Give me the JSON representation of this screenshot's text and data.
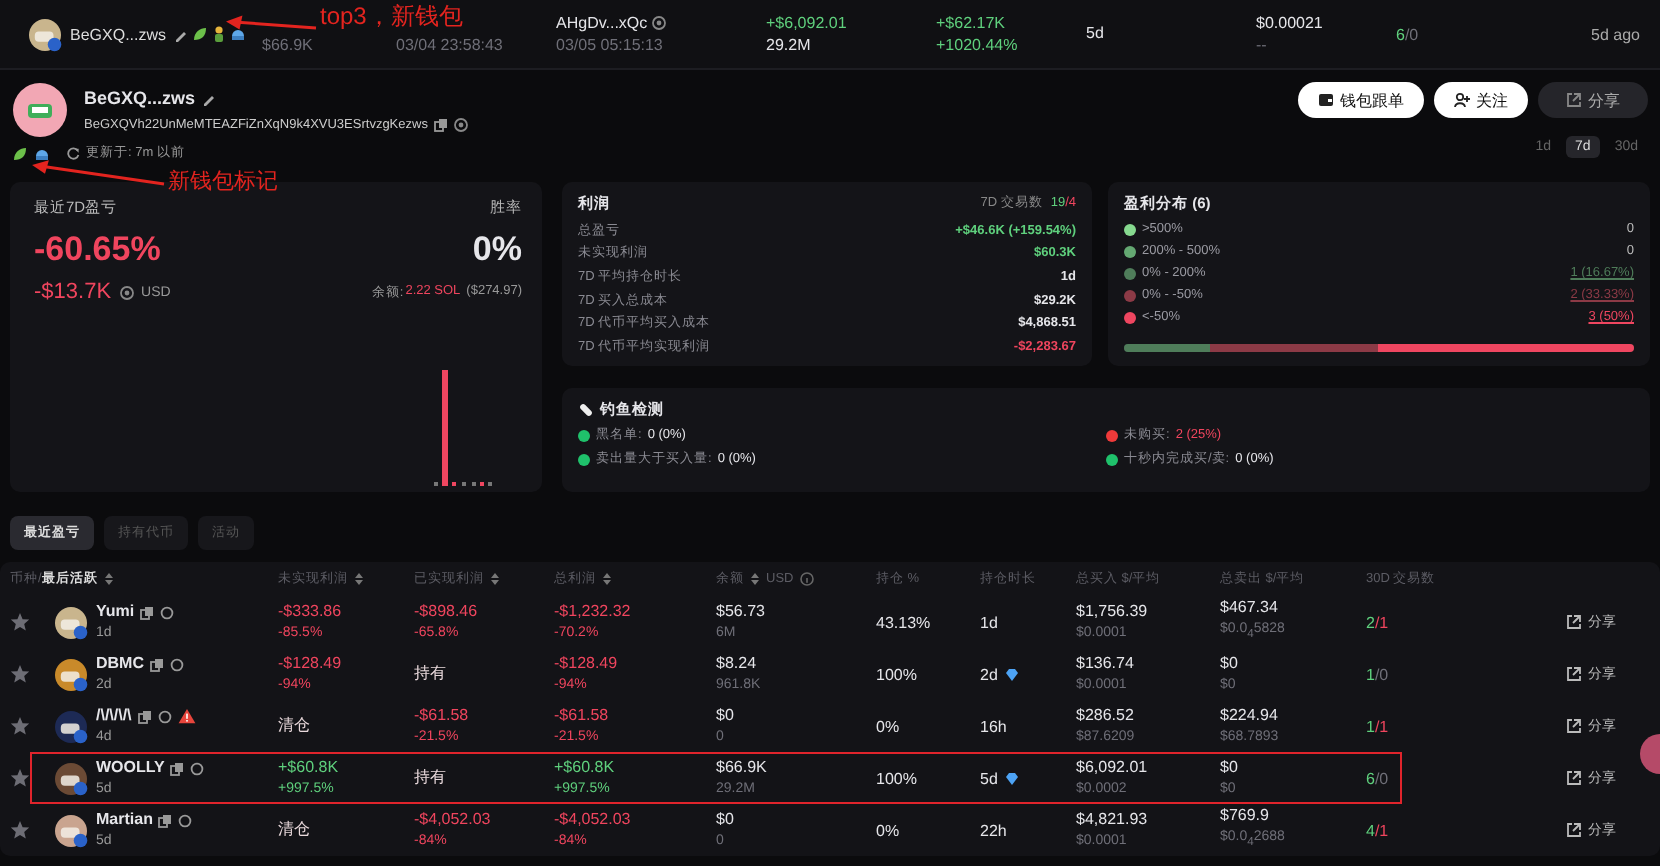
{
  "top_row": {
    "name": "BeGXQ...zws",
    "cells": [
      {
        "lines": [
          {
            "text": "$66.9K",
            "color": "#6f6f78"
          }
        ]
      },
      {
        "lines": [
          {
            "text": "03/04 23:58:43",
            "color": "#6f6f78"
          }
        ]
      },
      {
        "lines": [
          {
            "text": "AHgDv...xQc",
            "color": "#e6e6ea"
          },
          {
            "text": "03/05 05:15:13",
            "color": "#6f6f78"
          }
        ]
      },
      {
        "lines": [
          {
            "text": "+$6,092.01",
            "color": "#5fd07d"
          },
          {
            "text": "29.2M",
            "color": "#e6e6ea"
          }
        ]
      },
      {
        "lines": [
          {
            "text": "+$62.17K",
            "color": "#5fd07d"
          },
          {
            "text": "+1020.44%",
            "color": "#5fd07d"
          }
        ]
      },
      {
        "lines": [
          {
            "text": "5d",
            "color": "#e6e6ea"
          }
        ]
      },
      {
        "lines": [
          {
            "text": "$0.00021",
            "color": "#e6e6ea"
          },
          {
            "text": "--",
            "color": "#6f6f78"
          }
        ]
      }
    ],
    "buys": {
      "text": "6",
      "color": "#5fd07d"
    },
    "sells": {
      "text": "/0",
      "color": "#6f6f78"
    },
    "ago": "5d ago"
  },
  "profile": {
    "name": "BeGXQ...zws",
    "address": "BeGXQVh22UnMeMTEAZFiZnXqN9k4XVU3ESrtvzgKezws",
    "updated": "更新于: 7m 以前",
    "buttons": [
      {
        "label": "钱包跟单",
        "kind": "copytrade"
      },
      {
        "label": "关注",
        "kind": "follow"
      },
      {
        "label": "分享",
        "kind": "share"
      }
    ],
    "periods": [
      {
        "label": "1d",
        "selected": false
      },
      {
        "label": "7d",
        "selected": true
      },
      {
        "label": "30d",
        "selected": false
      }
    ]
  },
  "pnl": {
    "title": "最近7D盈亏",
    "winrate_title": "胜率",
    "percent": "-60.65%",
    "winrate": "0%",
    "amount": "-$13.7K",
    "currency": "USD",
    "balance_label": "余额:",
    "balance": "2.22 SOL",
    "balance_usd": "($274.97)"
  },
  "profit": {
    "title": "利润",
    "trades_label": "7D 交易数",
    "buys": {
      "text": "19",
      "color": "#5fd07d"
    },
    "sells": {
      "text": "/4",
      "color": "#f0455e"
    },
    "rows": [
      {
        "label": "总盈亏",
        "value": "+$46.6K (+159.54%)",
        "color": "#5fd07d"
      },
      {
        "label": "未实现利润",
        "value": "$60.3K",
        "color": "#5fd07d"
      },
      {
        "label": "7D 平均持仓时长",
        "value": "1d",
        "color": "#e6e6ea"
      },
      {
        "label": "7D 买入总成本",
        "value": "$29.2K",
        "color": "#e6e6ea"
      },
      {
        "label": "7D 代币平均买入成本",
        "value": "$4,868.51",
        "color": "#e6e6ea"
      },
      {
        "label": "7D 代币平均实现利润",
        "value": "-$2,283.67",
        "color": "#f0455e"
      }
    ]
  },
  "distribution": {
    "title": "盈利分布 (6)",
    "rows": [
      {
        "label": ">500%",
        "value": "0",
        "color": "#86d98f",
        "level": 0,
        "underlined": false
      },
      {
        "label": "200% - 500%",
        "value": "0",
        "color": "#64a872",
        "level": 0,
        "underlined": false
      },
      {
        "label": "0% - 200%",
        "value": "1 (16.67%)",
        "color": "#4f7d5a",
        "level": 0.1667,
        "underlined": true
      },
      {
        "label": "0% - -50%",
        "value": "2 (33.33%)",
        "color": "#8c3a46",
        "level": 0.3333,
        "underlined": true
      },
      {
        "label": "<-50%",
        "value": "3 (50%)",
        "color": "#ef4660",
        "level": 0.5,
        "underlined": true
      }
    ]
  },
  "phishing": {
    "title": "钓鱼检测",
    "items": [
      {
        "label": "黑名单:",
        "value": "0 (0%)",
        "color": "#1fc16b",
        "alert": false
      },
      {
        "label": "未购买:",
        "value": "2 (25%)",
        "color": "#f03a3a",
        "alert": true
      },
      {
        "label": "卖出量大于买入量:",
        "value": "0 (0%)",
        "color": "#1fc16b",
        "alert": false
      },
      {
        "label": "十秒内完成买/卖:",
        "value": "0 (0%)",
        "color": "#1fc16b",
        "alert": false
      }
    ]
  },
  "tabs": [
    {
      "label": "最近盈亏",
      "selected": true
    },
    {
      "label": "持有代币",
      "selected": false
    },
    {
      "label": "活动",
      "selected": false
    }
  ],
  "table": {
    "columns": [
      {
        "prefix": "币种/",
        "label": "最后活跃",
        "sortable": true
      },
      {
        "label": "未实现利润",
        "sortable": true
      },
      {
        "label": "已实现利润",
        "sortable": true
      },
      {
        "label": "总利润",
        "sortable": true
      },
      {
        "label": "余额",
        "sortable": true,
        "unit": "USD"
      },
      {
        "label": "持仓 %",
        "sortable": false
      },
      {
        "label": "持仓时长",
        "sortable": false
      },
      {
        "label": "总买入 $/平均",
        "sortable": false
      },
      {
        "label": "总卖出 $/平均",
        "sortable": false
      },
      {
        "label": "30D 交易数",
        "sortable": false
      }
    ],
    "rows": [
      {
        "name": "Yumi",
        "age": "1d",
        "warning": false,
        "boxed": false,
        "unrealized": {
          "main": "-$333.86",
          "sub": "-85.5%",
          "color": "#f0455e"
        },
        "realized": {
          "main": "-$898.46",
          "sub": "-65.8%",
          "color": "#f0455e"
        },
        "total": {
          "main": "-$1,232.32",
          "sub": "-70.2%",
          "color": "#f0455e"
        },
        "balance": {
          "main": "$56.73",
          "sub": "6M"
        },
        "hold": "43.13%",
        "duration": "1d",
        "diamond": false,
        "buy": {
          "main": "$1,756.39",
          "sub": "$0.0001"
        },
        "sell": {
          "main": "$467.34",
          "sub": "$0.0$_{4}$5828"
        },
        "buys": {
          "text": "2",
          "color": "#5fd07d"
        },
        "sells": {
          "text": "/1",
          "color": "#f0455e"
        },
        "share": "分享"
      },
      {
        "name": "DBMC",
        "age": "2d",
        "warning": false,
        "boxed": false,
        "unrealized": {
          "main": "-$128.49",
          "sub": "-94%",
          "color": "#f0455e"
        },
        "realized": {
          "label": "持有"
        },
        "total": {
          "main": "-$128.49",
          "sub": "-94%",
          "color": "#f0455e"
        },
        "balance": {
          "main": "$8.24",
          "sub": "961.8K"
        },
        "hold": "100%",
        "duration": "2d",
        "diamond": true,
        "buy": {
          "main": "$136.74",
          "sub": "$0.0001"
        },
        "sell": {
          "main": "$0",
          "sub": "$0"
        },
        "buys": {
          "text": "1",
          "color": "#5fd07d"
        },
        "sells": {
          "text": "/0",
          "color": "#6f6f78"
        },
        "share": "分享"
      },
      {
        "name": "/\\/\\/\\/\\",
        "age": "4d",
        "warning": true,
        "boxed": false,
        "unrealized": {
          "label": "清仓"
        },
        "realized": {
          "main": "-$61.58",
          "sub": "-21.5%",
          "color": "#f0455e"
        },
        "total": {
          "main": "-$61.58",
          "sub": "-21.5%",
          "color": "#f0455e"
        },
        "balance": {
          "main": "$0",
          "sub": "0"
        },
        "hold": "0%",
        "duration": "16h",
        "diamond": false,
        "buy": {
          "main": "$286.52",
          "sub": "$87.6209"
        },
        "sell": {
          "main": "$224.94",
          "sub": "$68.7893"
        },
        "buys": {
          "text": "1",
          "color": "#5fd07d"
        },
        "sells": {
          "text": "/1",
          "color": "#f0455e"
        },
        "share": "分享"
      },
      {
        "name": "WOOLLY",
        "age": "5d",
        "warning": false,
        "boxed": true,
        "unrealized": {
          "main": "+$60.8K",
          "sub": "+997.5%",
          "color": "#5fd07d"
        },
        "realized": {
          "label": "持有"
        },
        "total": {
          "main": "+$60.8K",
          "sub": "+997.5%",
          "color": "#5fd07d"
        },
        "balance": {
          "main": "$66.9K",
          "sub": "29.2M"
        },
        "hold": "100%",
        "duration": "5d",
        "diamond": true,
        "buy": {
          "main": "$6,092.01",
          "sub": "$0.0002"
        },
        "sell": {
          "main": "$0",
          "sub": "$0"
        },
        "buys": {
          "text": "6",
          "color": "#5fd07d"
        },
        "sells": {
          "text": "/0",
          "color": "#6f6f78"
        },
        "share": "分享"
      },
      {
        "name": "Martian",
        "age": "5d",
        "warning": false,
        "boxed": false,
        "unrealized": {
          "label": "清仓"
        },
        "realized": {
          "main": "-$4,052.03",
          "sub": "-84%",
          "color": "#f0455e"
        },
        "total": {
          "main": "-$4,052.03",
          "sub": "-84%",
          "color": "#f0455e"
        },
        "balance": {
          "main": "$0",
          "sub": "0"
        },
        "hold": "0%",
        "duration": "22h",
        "diamond": false,
        "buy": {
          "main": "$4,821.93",
          "sub": "$0.0001"
        },
        "sell": {
          "main": "$769.9",
          "sub": "$0.0$_{4}$2688"
        },
        "buys": {
          "text": "4",
          "color": "#5fd07d"
        },
        "sells": {
          "text": "/1",
          "color": "#f0455e"
        },
        "share": "分享"
      }
    ]
  },
  "annotations": [
    {
      "text": "top3，新钱包"
    },
    {
      "text": "新钱包标记"
    }
  ]
}
